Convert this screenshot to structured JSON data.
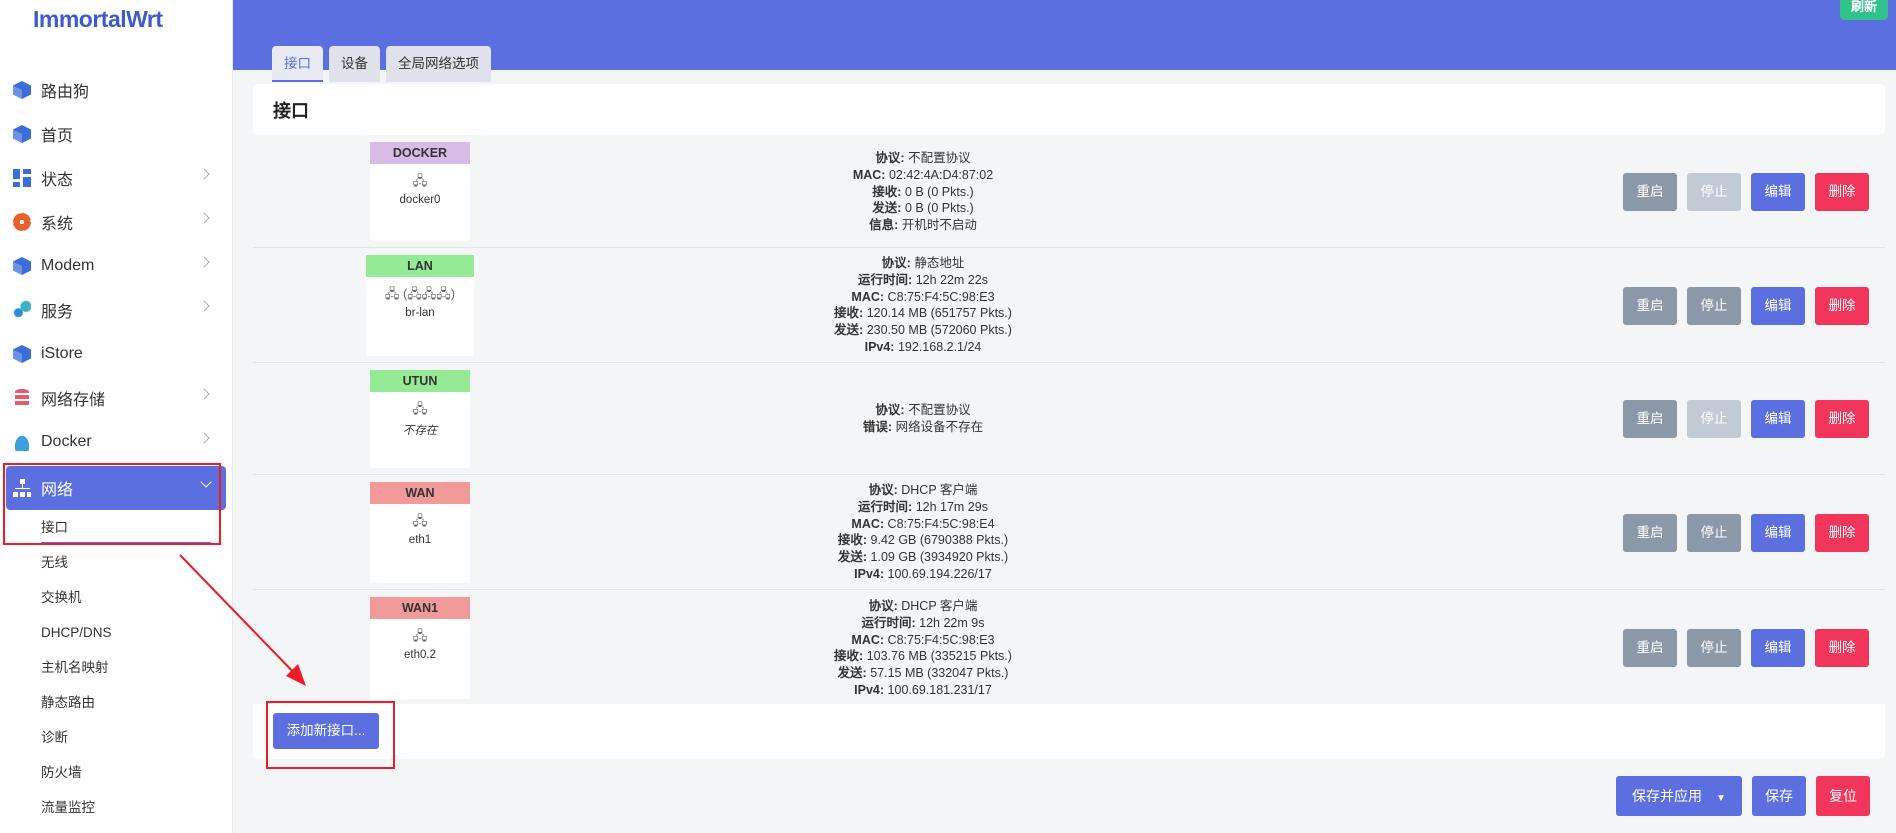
{
  "app": {
    "logo": "ImmortalWrt",
    "refresh_label": "刷新"
  },
  "sidebar": {
    "items": [
      {
        "label": "路由狗",
        "icon": "cube-icon",
        "has_chevron": false
      },
      {
        "label": "首页",
        "icon": "cube-icon",
        "has_chevron": false
      },
      {
        "label": "状态",
        "icon": "dashboard-icon",
        "has_chevron": true
      },
      {
        "label": "系统",
        "icon": "gear-icon",
        "has_chevron": true
      },
      {
        "label": "Modem",
        "icon": "cube-icon",
        "has_chevron": true
      },
      {
        "label": "服务",
        "icon": "services-icon",
        "has_chevron": true
      },
      {
        "label": "iStore",
        "icon": "cube-icon",
        "has_chevron": false
      },
      {
        "label": "网络存储",
        "icon": "database-icon",
        "has_chevron": true
      },
      {
        "label": "Docker",
        "icon": "docker-icon",
        "has_chevron": true
      }
    ],
    "active_item": {
      "label": "网络",
      "icon": "network-icon"
    },
    "sub_items": [
      "接口",
      "无线",
      "交换机",
      "DHCP/DNS",
      "主机名映射",
      "静态路由",
      "诊断",
      "防火墙",
      "流量监控"
    ],
    "current_sub": "接口"
  },
  "tabs": [
    "接口",
    "设备",
    "全局网络选项"
  ],
  "section_title": "接口",
  "interfaces": [
    {
      "name": "DOCKER",
      "color": "#d7bce8",
      "icon": "🖧",
      "device": "docker0",
      "missing": false,
      "info": [
        [
          "协议:",
          "不配置协议"
        ],
        [
          "MAC:",
          "02:42:4A:D4:87:02"
        ],
        [
          "接收:",
          "0 B (0 Pkts.)"
        ],
        [
          "发送:",
          "0 B (0 Pkts.)"
        ],
        [
          "信息:",
          "开机时不启动"
        ]
      ],
      "stop_disabled": true
    },
    {
      "name": "LAN",
      "color": "#95ea95",
      "icon": "🖧 (🖧🖧🖧)",
      "device": "br-lan",
      "missing": false,
      "info": [
        [
          "协议:",
          "静态地址"
        ],
        [
          "运行时间:",
          "12h 22m 22s"
        ],
        [
          "MAC:",
          "C8:75:F4:5C:98:E3"
        ],
        [
          "接收:",
          "120.14 MB (651757 Pkts.)"
        ],
        [
          "发送:",
          "230.50 MB (572060 Pkts.)"
        ],
        [
          "IPv4:",
          "192.168.2.1/24"
        ]
      ],
      "stop_disabled": false
    },
    {
      "name": "UTUN",
      "color": "#95ea95",
      "icon": "🖧",
      "device": "不存在",
      "missing": true,
      "info": [
        [
          "协议:",
          "不配置协议"
        ],
        [
          "错误:",
          "网络设备不存在"
        ]
      ],
      "stop_disabled": true
    },
    {
      "name": "WAN",
      "color": "#f29999",
      "icon": "🖧",
      "device": "eth1",
      "missing": false,
      "info": [
        [
          "协议:",
          "DHCP 客户端"
        ],
        [
          "运行时间:",
          "12h 17m 29s"
        ],
        [
          "MAC:",
          "C8:75:F4:5C:98:E4"
        ],
        [
          "接收:",
          "9.42 GB (6790388 Pkts.)"
        ],
        [
          "发送:",
          "1.09 GB (3934920 Pkts.)"
        ],
        [
          "IPv4:",
          "100.69.194.226/17"
        ]
      ],
      "stop_disabled": false
    },
    {
      "name": "WAN1",
      "color": "#f29999",
      "icon": "🖧",
      "device": "eth0.2",
      "missing": false,
      "info": [
        [
          "协议:",
          "DHCP 客户端"
        ],
        [
          "运行时间:",
          "12h 22m 9s"
        ],
        [
          "MAC:",
          "C8:75:F4:5C:98:E3"
        ],
        [
          "接收:",
          "103.76 MB (335215 Pkts.)"
        ],
        [
          "发送:",
          "57.15 MB (332047 Pkts.)"
        ],
        [
          "IPv4:",
          "100.69.181.231/17"
        ]
      ],
      "stop_disabled": false
    }
  ],
  "row_buttons": {
    "restart": "重启",
    "stop": "停止",
    "edit": "编辑",
    "delete": "删除"
  },
  "add_button": "添加新接口...",
  "bottom": {
    "save_apply": "保存并应用",
    "save": "保存",
    "reset": "复位"
  },
  "colors": {
    "accent": "#5b6fe0",
    "danger": "#f2355a",
    "success": "#2fc28a",
    "muted": "#8a98a8",
    "annotation": "#ee1c24"
  }
}
